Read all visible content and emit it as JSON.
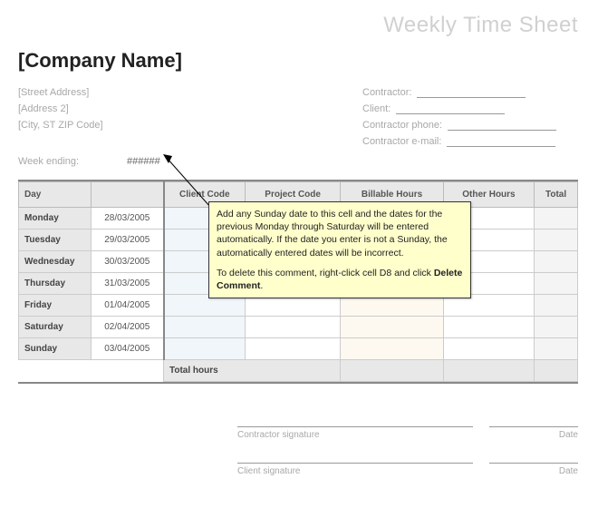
{
  "page_title": "Weekly Time Sheet",
  "company_name": "[Company Name]",
  "address": {
    "street": "[Street Address]",
    "line2": "[Address 2]",
    "city_zip": "[City, ST  ZIP Code]"
  },
  "fields": {
    "contractor": "Contractor:",
    "client": "Client:",
    "phone": "Contractor phone:",
    "email": "Contractor e-mail:"
  },
  "week_ending_label": "Week ending:",
  "week_ending_value": "######",
  "headers": {
    "day": "Day",
    "client_code": "Client Code",
    "project_code": "Project Code",
    "billable": "Billable Hours",
    "other": "Other Hours",
    "total": "Total"
  },
  "rows": [
    {
      "day": "Monday",
      "date": "28/03/2005"
    },
    {
      "day": "Tuesday",
      "date": "29/03/2005"
    },
    {
      "day": "Wednesday",
      "date": "30/03/2005"
    },
    {
      "day": "Thursday",
      "date": "31/03/2005"
    },
    {
      "day": "Friday",
      "date": "01/04/2005"
    },
    {
      "day": "Saturday",
      "date": "02/04/2005"
    },
    {
      "day": "Sunday",
      "date": "03/04/2005"
    }
  ],
  "total_hours_label": "Total hours",
  "signatures": {
    "contractor": "Contractor signature",
    "client": "Client signature",
    "date": "Date"
  },
  "comment": {
    "para1": "Add any Sunday date to this cell and the dates for the previous Monday through Saturday will be entered automatically. If the date you enter is not a Sunday, the automatically entered dates will be incorrect.",
    "para2_a": "To delete this comment, right-click cell D8 and click ",
    "para2_b": "Delete Comment",
    "para2_c": "."
  }
}
